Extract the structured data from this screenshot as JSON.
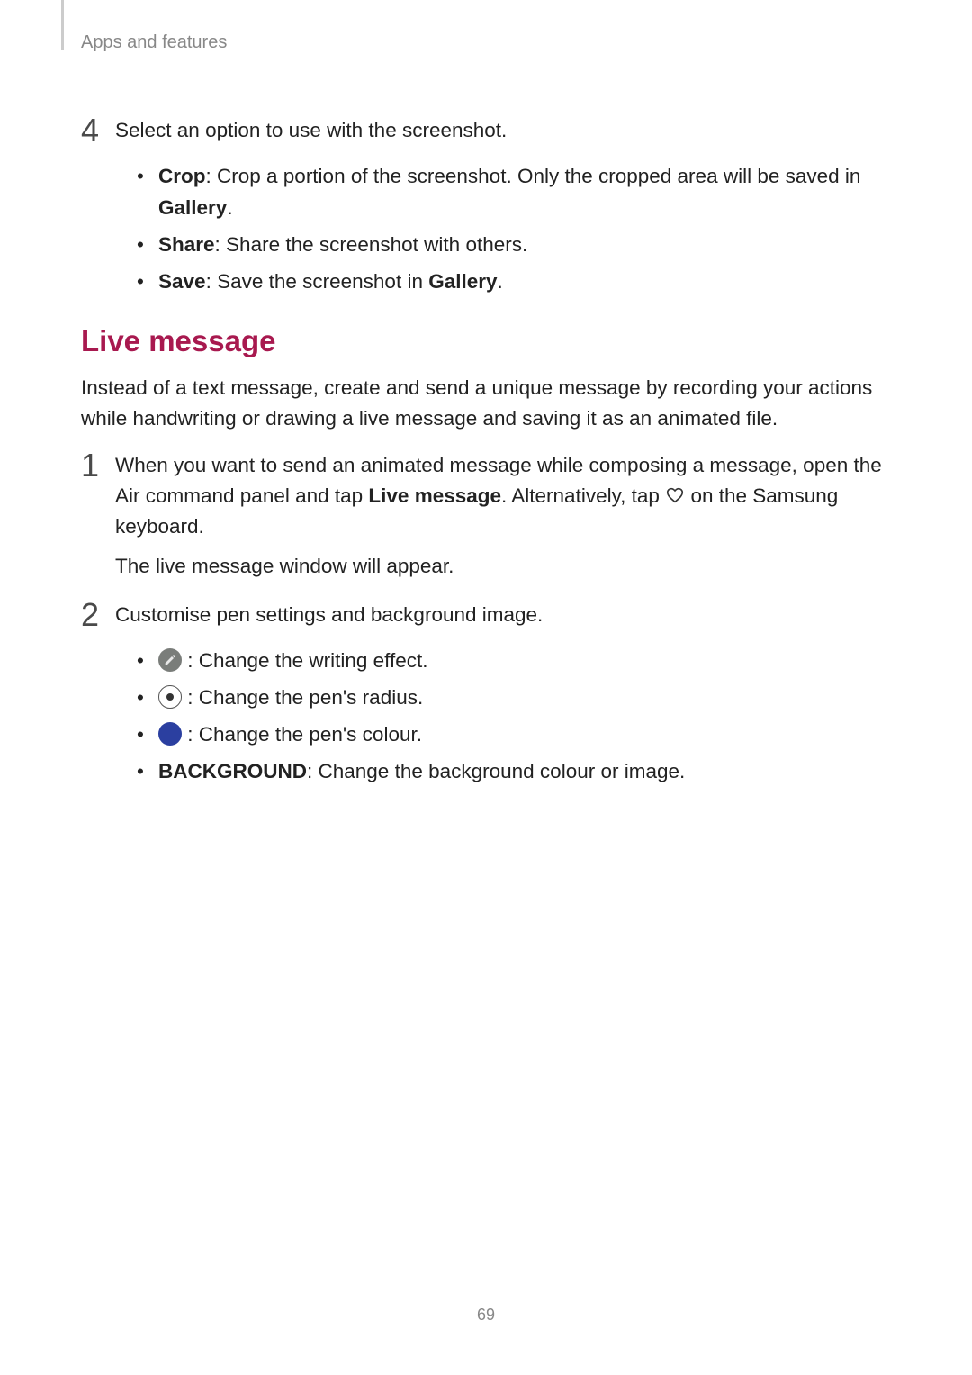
{
  "header": {
    "section": "Apps and features"
  },
  "page_number": "69",
  "step4": {
    "num": "4",
    "intro": "Select an option to use with the screenshot.",
    "items": [
      {
        "bold": "Crop",
        "rest_a": ": Crop a portion of the screenshot. Only the cropped area will be saved in ",
        "bold2": "Gallery",
        "rest_b": "."
      },
      {
        "bold": "Share",
        "rest_a": ": Share the screenshot with others.",
        "bold2": "",
        "rest_b": ""
      },
      {
        "bold": "Save",
        "rest_a": ": Save the screenshot in ",
        "bold2": "Gallery",
        "rest_b": "."
      }
    ]
  },
  "heading": "Live message",
  "intro_para": "Instead of a text message, create and send a unique message by recording your actions while handwriting or drawing a live message and saving it as an animated file.",
  "step1": {
    "num": "1",
    "line_a": "When you want to send an animated message while composing a message, open the Air command panel and tap ",
    "bold_a": "Live message",
    "line_b": ". Alternatively, tap ",
    "line_c": " on the Samsung keyboard.",
    "follow": "The live message window will appear."
  },
  "step2": {
    "num": "2",
    "intro": "Customise pen settings and background image.",
    "items": [
      {
        "icon": "pen-effect",
        "text": " : Change the writing effect."
      },
      {
        "icon": "radius",
        "text": " : Change the pen's radius."
      },
      {
        "icon": "colour",
        "text": " : Change the pen's colour."
      },
      {
        "bold": "BACKGROUND",
        "text": ": Change the background colour or image."
      }
    ]
  }
}
